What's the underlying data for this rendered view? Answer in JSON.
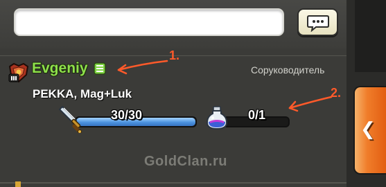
{
  "chat": {
    "input_value": "",
    "input_placeholder": "",
    "send_icon": "speech-bubble-icon"
  },
  "member": {
    "league_icon": "league-badge-icon",
    "name": "Evgeniy",
    "status_icon": "online-status-icon",
    "role": "Соруководитель",
    "troops_text": "PEKKA, Mag+Luk",
    "troop_count": "30/30",
    "troop_fill": 1.0,
    "spell_count": "0/1",
    "spell_fill": 0.0
  },
  "annotations": [
    {
      "label": "1."
    },
    {
      "label": "2."
    }
  ],
  "watermark": "GoldClan.ru",
  "collapse_tab": {
    "icon": "chevron-left-icon",
    "glyph": "❮"
  },
  "colors": {
    "name_green": "#8ee04b",
    "tab_orange": "#f07d2a",
    "annotation_red": "#ff5a2a",
    "troop_blue": "#4c93e0"
  }
}
